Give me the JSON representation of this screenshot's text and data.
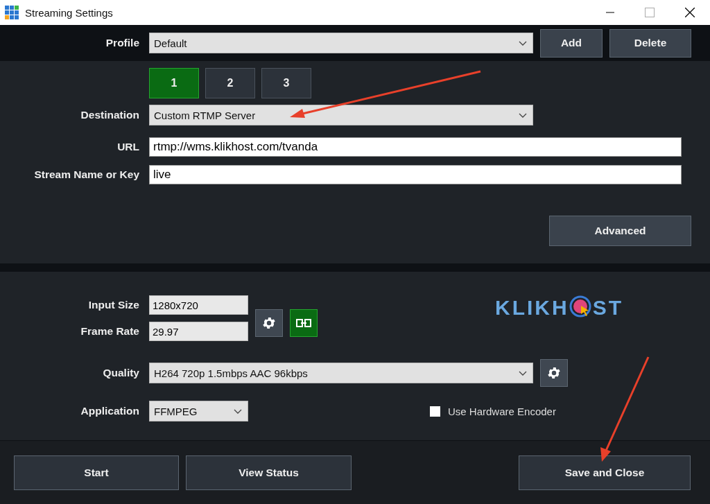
{
  "window": {
    "title": "Streaming Settings"
  },
  "profile": {
    "label": "Profile",
    "value": "Default",
    "buttons": [
      "Add",
      "Delete"
    ]
  },
  "tabs": [
    {
      "label": "1",
      "selected": true
    },
    {
      "label": "2",
      "selected": false
    },
    {
      "label": "3",
      "selected": false
    }
  ],
  "destination": {
    "label": "Destination",
    "value": "Custom RTMP Server"
  },
  "url": {
    "label": "URL",
    "value": "rtmp://wms.klikhost.com/tvanda"
  },
  "stream_key": {
    "label": "Stream Name or Key",
    "value": "live"
  },
  "advanced_button": "Advanced",
  "input_size": {
    "label": "Input Size",
    "value": "1280x720"
  },
  "frame_rate": {
    "label": "Frame Rate",
    "value": "29.97"
  },
  "logo": {
    "text_before": "KLIKH",
    "text_after": "ST"
  },
  "quality": {
    "label": "Quality",
    "value": "H264 720p 1.5mbps AAC 96kbps"
  },
  "application": {
    "label": "Application",
    "value": "FFMPEG"
  },
  "hardware_encoder": {
    "label": "Use Hardware Encoder",
    "checked": false
  },
  "bottom_buttons": [
    "Start",
    "View Status",
    "Save and Close"
  ]
}
